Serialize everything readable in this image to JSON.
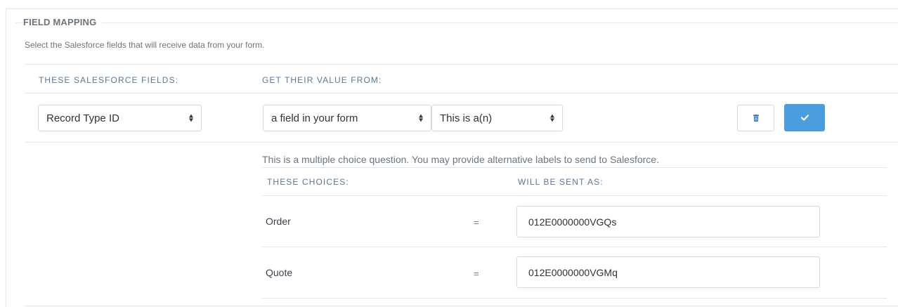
{
  "section": {
    "legend": "FIELD MAPPING",
    "description": "Select the Salesforce fields that will receive data from your form."
  },
  "columns": {
    "salesforce_fields": "THESE SALESFORCE FIELDS:",
    "value_from": "GET THEIR VALUE FROM:"
  },
  "mapping": {
    "salesforce_field": "Record Type ID",
    "source_type": "a field in your form",
    "source_field": "This is a(n)",
    "delete_icon": "trash-icon",
    "confirm_icon": "check-icon",
    "accent_color": "#4a9ee0"
  },
  "choices": {
    "note": "This is a multiple choice question. You may provide alternative labels to send to Salesforce.",
    "head_choices": "THESE CHOICES:",
    "head_sent_as": "WILL BE SENT AS:",
    "rows": [
      {
        "label": "Order",
        "equals": "=",
        "value": "012E0000000VGQs"
      },
      {
        "label": "Quote",
        "equals": "=",
        "value": "012E0000000VGMq"
      }
    ]
  }
}
